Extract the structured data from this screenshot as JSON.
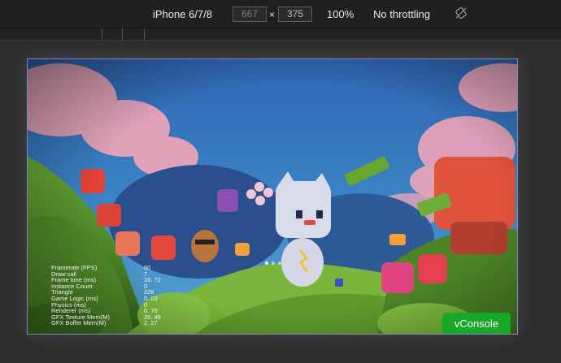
{
  "toolbar": {
    "device": "iPhone 6/7/8",
    "width_value": "667",
    "height_value": "375",
    "times": "×",
    "zoom": "100%",
    "throttling": "No throttling",
    "rotate_icon": "rotate-icon"
  },
  "stats": {
    "rows": [
      {
        "label": "Framerate (FPS)",
        "value": "60"
      },
      {
        "label": "Draw call",
        "value": "7"
      },
      {
        "label": "Frame time (ms)",
        "value": "16. 72"
      },
      {
        "label": "Instance Count",
        "value": "0"
      },
      {
        "label": "Triangle",
        "value": "226"
      },
      {
        "label": "Game Logic (ms)",
        "value": "0. 03"
      },
      {
        "label": "Physics (ms)",
        "value": "0"
      },
      {
        "label": "Renderer (ms)",
        "value": "0. 76"
      },
      {
        "label": "GFX Texture Mem(M)",
        "value": "20. 49"
      },
      {
        "label": "GFX Buffer Mem(M)",
        "value": "2. 27"
      }
    ]
  },
  "pager": {
    "count": 3,
    "active": 0
  },
  "vconsole": {
    "label": "vConsole",
    "color": "#17a829"
  }
}
